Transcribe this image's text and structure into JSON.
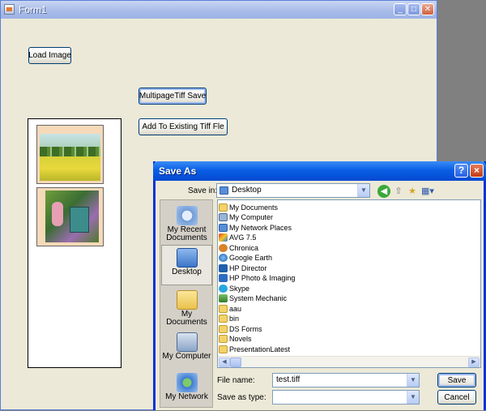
{
  "form1": {
    "title": "Form1",
    "buttons": {
      "load_image": "Load Image",
      "multipage_save": "MultipageTiff Save",
      "add_existing": "Add To Existing Tiff Fle"
    }
  },
  "dialog": {
    "title": "Save As",
    "help_glyph": "?",
    "close_glyph": "×",
    "save_in_label": "Save in:",
    "save_in_value": "Desktop",
    "places": [
      {
        "label": "My Recent Documents",
        "icon": "recent-documents-icon"
      },
      {
        "label": "Desktop",
        "icon": "desktop-icon"
      },
      {
        "label": "My Documents",
        "icon": "my-documents-icon"
      },
      {
        "label": "My Computer",
        "icon": "my-computer-icon"
      },
      {
        "label": "My Network",
        "icon": "my-network-icon"
      }
    ],
    "files": [
      {
        "name": "My Documents",
        "icon": "my-documents-icon"
      },
      {
        "name": "My Computer",
        "icon": "my-computer-icon"
      },
      {
        "name": "My Network Places",
        "icon": "network-places-icon"
      },
      {
        "name": "AVG 7.5",
        "icon": "avg-icon"
      },
      {
        "name": "Chronica",
        "icon": "chronica-icon"
      },
      {
        "name": "Google Earth",
        "icon": "google-earth-icon"
      },
      {
        "name": "HP Director",
        "icon": "hp-director-icon"
      },
      {
        "name": "HP Photo & Imaging",
        "icon": "hp-photo-icon"
      },
      {
        "name": "Skype",
        "icon": "skype-icon"
      },
      {
        "name": "System Mechanic",
        "icon": "system-mechanic-icon"
      },
      {
        "name": "aau",
        "icon": "folder-icon"
      },
      {
        "name": "bin",
        "icon": "folder-icon"
      },
      {
        "name": "DS Forms",
        "icon": "folder-icon"
      },
      {
        "name": "Novels",
        "icon": "folder-icon"
      },
      {
        "name": "PresentationLatest",
        "icon": "folder-icon"
      }
    ],
    "file_name_label": "File name:",
    "file_name_value": "test.tiff",
    "save_type_label": "Save as type:",
    "save_type_value": "",
    "save_button": "Save",
    "cancel_button": "Cancel"
  },
  "colors": {
    "folder": "#f3d267",
    "dialog_title": "#0a5fe5"
  }
}
